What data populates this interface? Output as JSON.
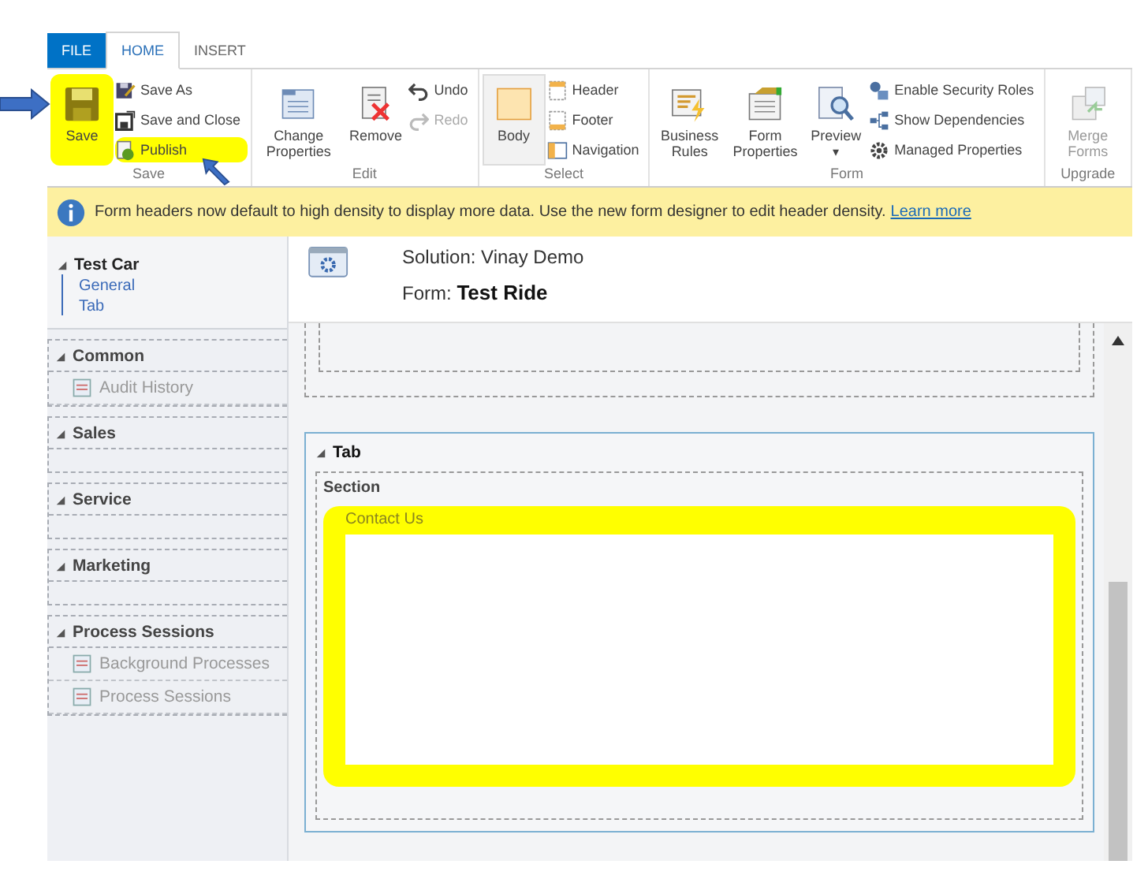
{
  "tabs": [
    {
      "label": "FILE",
      "kind": "file",
      "selected": false
    },
    {
      "label": "HOME",
      "kind": "tab",
      "selected": true
    },
    {
      "label": "INSERT",
      "kind": "tab",
      "selected": false
    }
  ],
  "ribbon": {
    "groups": [
      {
        "label": "Save",
        "items": [
          {
            "kind": "large",
            "label": "Save",
            "disabled": false,
            "selected": false
          },
          {
            "kind": "small",
            "label": "Save As",
            "disabled": false
          },
          {
            "kind": "small",
            "label": "Save and Close",
            "disabled": false
          },
          {
            "kind": "small",
            "label": "Publish",
            "disabled": false
          }
        ]
      },
      {
        "label": "Edit",
        "items": [
          {
            "kind": "large",
            "label": "Change Properties",
            "disabled": false,
            "selected": false
          },
          {
            "kind": "large",
            "label": "Remove",
            "disabled": false,
            "selected": false
          },
          {
            "kind": "small",
            "label": "Undo",
            "disabled": false
          },
          {
            "kind": "small",
            "label": "Redo",
            "disabled": true
          }
        ]
      },
      {
        "label": "Select",
        "items": [
          {
            "kind": "large",
            "label": "Body",
            "disabled": false,
            "selected": true
          },
          {
            "kind": "small",
            "label": "Header",
            "disabled": false
          },
          {
            "kind": "small",
            "label": "Footer",
            "disabled": false
          },
          {
            "kind": "small",
            "label": "Navigation",
            "disabled": false
          }
        ]
      },
      {
        "label": "Form",
        "items": [
          {
            "kind": "large",
            "label": "Business Rules",
            "disabled": false,
            "selected": false
          },
          {
            "kind": "large",
            "label": "Form Properties",
            "disabled": false,
            "selected": false
          },
          {
            "kind": "large",
            "label": "Preview",
            "disabled": false,
            "selected": false,
            "dropdown": "▾"
          },
          {
            "kind": "small",
            "label": "Enable Security Roles",
            "disabled": false
          },
          {
            "kind": "small",
            "label": "Show Dependencies",
            "disabled": false
          },
          {
            "kind": "small",
            "label": "Managed Properties",
            "disabled": false
          }
        ]
      },
      {
        "label": "Upgrade",
        "items": [
          {
            "kind": "large",
            "label": "Merge Forms",
            "disabled": true,
            "selected": false
          }
        ]
      }
    ]
  },
  "notification": {
    "text": "Form headers now default to high density to display more data. Use the new form designer to edit header density.",
    "link": "Learn more"
  },
  "sidebar": {
    "tree": {
      "label": "Test Car",
      "expanded": true,
      "children": [
        {
          "label": "General"
        },
        {
          "label": "Tab"
        }
      ]
    },
    "sections": [
      {
        "label": "Common",
        "expanded": true,
        "items": [
          {
            "label": "Audit History",
            "disabled": true
          }
        ]
      },
      {
        "label": "Sales",
        "expanded": true
      },
      {
        "label": "Service",
        "expanded": true
      },
      {
        "label": "Marketing",
        "expanded": true
      },
      {
        "label": "Process Sessions",
        "expanded": true,
        "items": [
          {
            "label": "Background Processes",
            "disabled": true
          },
          {
            "label": "Process Sessions",
            "disabled": true
          }
        ]
      }
    ]
  },
  "header": {
    "solution": "Solution: Vinay Demo",
    "form_label": "Form:",
    "form_name": "Test Ride"
  },
  "canvas": {
    "tab": {
      "label": "Tab",
      "expanded": true,
      "section": {
        "label": "Section",
        "field": {
          "label": "Contact Us"
        }
      }
    }
  }
}
